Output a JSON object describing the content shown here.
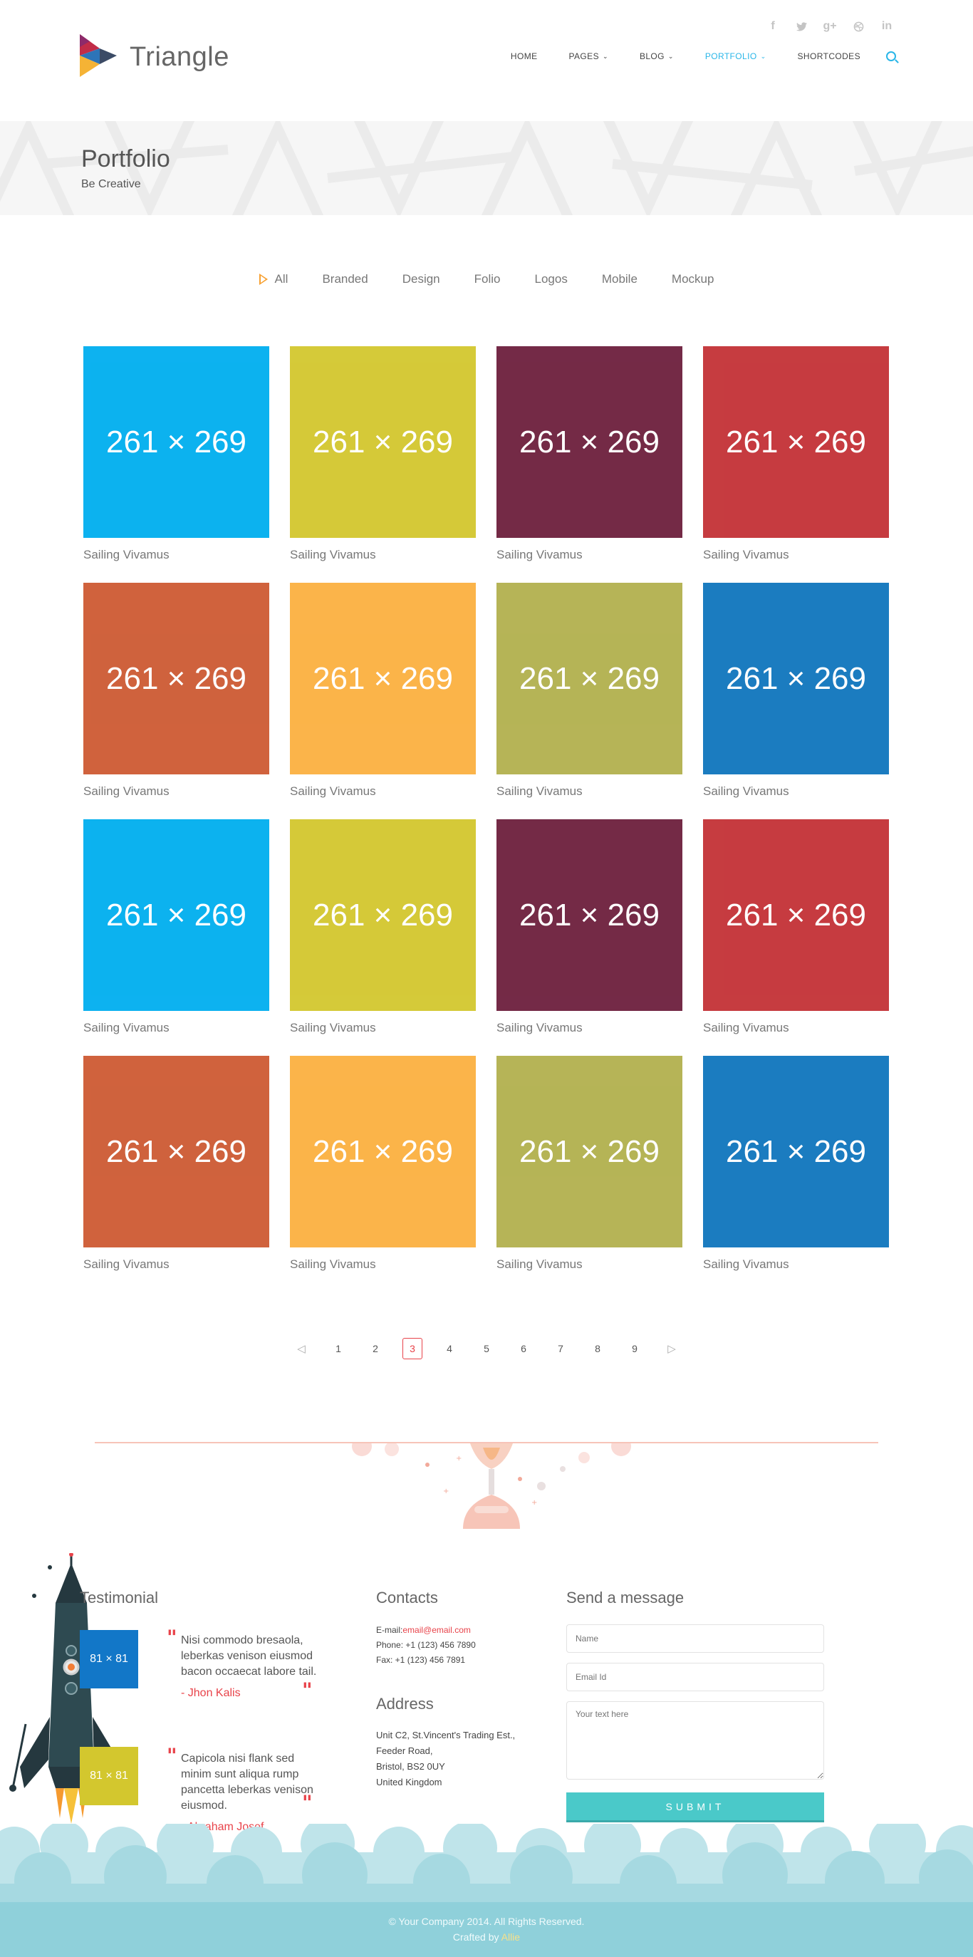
{
  "brand": {
    "name": "Triangle"
  },
  "social": [
    "facebook-icon",
    "twitter-icon",
    "google-plus-icon",
    "dribbble-icon",
    "linkedin-icon"
  ],
  "nav": {
    "items": [
      {
        "label": "HOME",
        "dropdown": false,
        "active": false
      },
      {
        "label": "PAGES",
        "dropdown": true,
        "active": false
      },
      {
        "label": "BLOG",
        "dropdown": true,
        "active": false
      },
      {
        "label": "PORTFOLIO",
        "dropdown": true,
        "active": true
      },
      {
        "label": "SHORTCODES",
        "dropdown": false,
        "active": false
      }
    ]
  },
  "banner": {
    "title": "Portfolio",
    "subtitle": "Be Creative"
  },
  "filters": [
    "All",
    "Branded",
    "Design",
    "Folio",
    "Logos",
    "Mobile",
    "Mockup"
  ],
  "portfolio": {
    "placeholder": "261 × 269",
    "item_title": "Sailing Vivamus",
    "colors": [
      "#00aeef",
      "#d3c72e",
      "#6d1f3d",
      "#c33136",
      "#cd5a33",
      "#fbb040",
      "#b2b04e",
      "#0f75bd",
      "#00aeef",
      "#d3c72e",
      "#6d1f3d",
      "#c33136",
      "#cd5a33",
      "#fbb040",
      "#b2b04e",
      "#0f75bd"
    ]
  },
  "pagination": {
    "pages": [
      "1",
      "2",
      "3",
      "4",
      "5",
      "6",
      "7",
      "8",
      "9"
    ],
    "current": "3"
  },
  "testimonial": {
    "title": "Testimonial",
    "img_label": "81 × 81",
    "items": [
      {
        "text": "Nisi commodo bresaola, leberkas venison eiusmod bacon occaecat labore tail.",
        "author": "- Jhon Kalis"
      },
      {
        "text": "Capicola nisi flank sed minim sunt aliqua rump pancetta leberkas venison eiusmod.",
        "author": "- Abraham Josef"
      }
    ]
  },
  "contacts": {
    "title": "Contacts",
    "email_label": "E-mail:",
    "email": "email@email.com",
    "phone": "Phone: +1 (123) 456 7890",
    "fax": "Fax: +1 (123) 456 7891",
    "address_title": "Address",
    "address": [
      "Unit C2, St.Vincent's Trading Est.,",
      "Feeder Road,",
      "Bristol, BS2 0UY",
      "United Kingdom"
    ]
  },
  "message": {
    "title": "Send a message",
    "name_placeholder": "Name",
    "email_placeholder": "Email Id",
    "text_placeholder": "Your text here",
    "submit": "SUBMIT"
  },
  "footer": {
    "copyright": "© Your Company 2014. All Rights Reserved.",
    "crafted": "Crafted by",
    "author": "Allie"
  }
}
